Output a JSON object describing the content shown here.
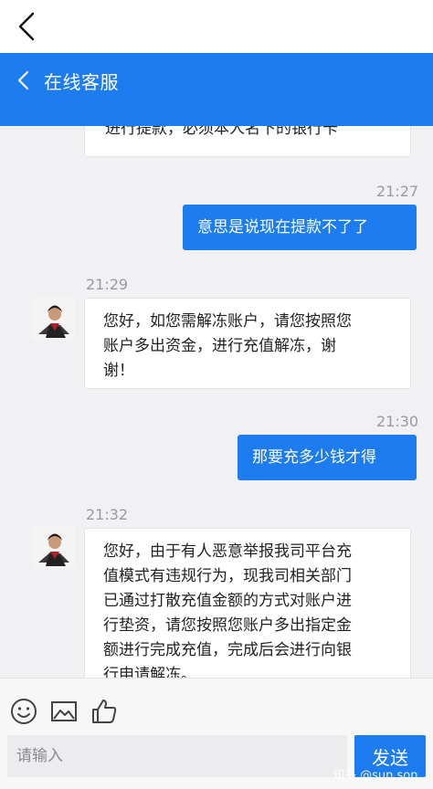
{
  "header": {
    "title": "在线客服",
    "accent": "#1c7cf0"
  },
  "messages": [
    {
      "side": "in",
      "time": "",
      "text": "进行提款，必须本人名下的银行卡"
    },
    {
      "side": "out",
      "time": "21:27",
      "text": "意思是说现在提款不了了"
    },
    {
      "side": "in",
      "time": "21:29",
      "lines": [
        "您好，如您需解冻账户，请您按照您",
        "账户多出资金，进行充值解冻，谢",
        "谢！"
      ]
    },
    {
      "side": "out",
      "time": "21:30",
      "text": "那要充多少钱才得"
    },
    {
      "side": "in",
      "time": "21:32",
      "lines": [
        "您好，由于有人恶意举报我司平台充",
        "值模式有违规行为，现我司相关部门",
        "已通过打散充值金额的方式对账户进",
        "行垫资，请您按照您账户多出指定金",
        "额进行完成充值，完成后会进行向银",
        "行申请解冻。"
      ]
    }
  ],
  "toolbar": {
    "icons": [
      "emoji-icon",
      "image-icon",
      "thumbs-up-icon"
    ],
    "input_placeholder": "请输入",
    "send_label": "发送"
  },
  "watermark": "知乎 @sun son"
}
